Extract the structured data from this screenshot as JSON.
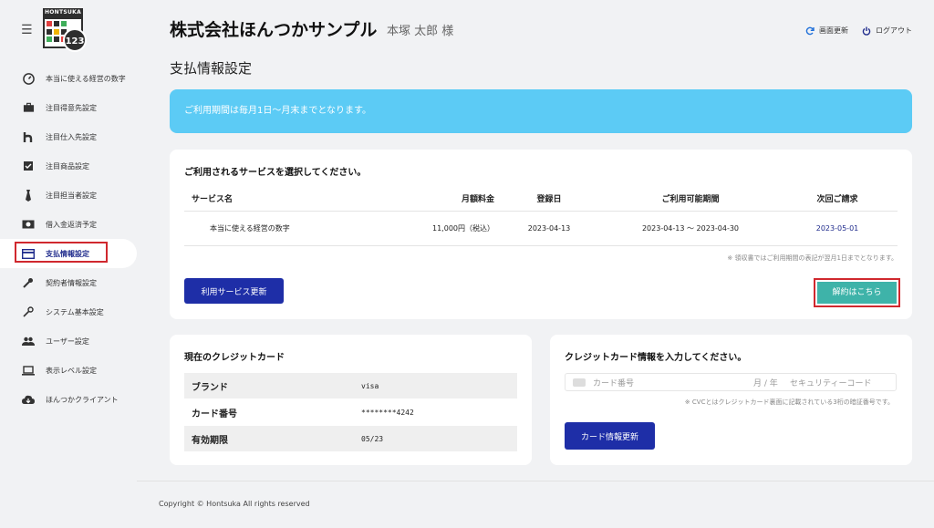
{
  "logo": {
    "text": "HONTSUKA",
    "badge": "123"
  },
  "sidebar": {
    "items": [
      {
        "label": "本当に使える経営の数字",
        "icon": "gauge-icon"
      },
      {
        "label": "注目得意先設定",
        "icon": "briefcase-icon"
      },
      {
        "label": "注目仕入先設定",
        "icon": "h-icon"
      },
      {
        "label": "注目商品設定",
        "icon": "checkbox-icon"
      },
      {
        "label": "注目担当者設定",
        "icon": "tie-icon"
      },
      {
        "label": "借入金返済予定",
        "icon": "money-icon"
      },
      {
        "label": "支払情報設定",
        "icon": "credit-card-icon",
        "active": true
      },
      {
        "label": "契約者情報設定",
        "icon": "wrench-icon"
      },
      {
        "label": "システム基本設定",
        "icon": "wrench-icon"
      },
      {
        "label": "ユーザー設定",
        "icon": "people-icon"
      },
      {
        "label": "表示レベル設定",
        "icon": "laptop-icon"
      },
      {
        "label": "ほんつかクライアント",
        "icon": "cloud-download-icon"
      }
    ]
  },
  "header": {
    "company": "株式会社ほんつかサンプル",
    "user": "本塚 太郎 様",
    "refresh_label": "画面更新",
    "logout_label": "ログアウト"
  },
  "page_title": "支払情報設定",
  "info_banner": "ご利用期間は毎月1日～月末までとなります。",
  "services": {
    "title": "ご利用されるサービスを選択してください。",
    "columns": [
      "サービス名",
      "月額料金",
      "登録日",
      "ご利用可能期間",
      "次回ご請求"
    ],
    "rows": [
      [
        "本当に使える経営の数字",
        "11,000円（税込）",
        "2023-04-13",
        "2023-04-13 ～ 2023-04-30",
        "2023-05-01"
      ]
    ],
    "note": "※ 領収書ではご利用期間の表記が翌月1日までとなります。",
    "update_button": "利用サービス更新",
    "cancel_button": "解約はこちら"
  },
  "current_card": {
    "title": "現在のクレジットカード",
    "rows": [
      {
        "key": "ブランド",
        "value": "visa"
      },
      {
        "key": "カード番号",
        "value": "********4242"
      },
      {
        "key": "有効期限",
        "value": "05/23"
      }
    ]
  },
  "new_card": {
    "title": "クレジットカード情報を入力してください。",
    "card_number_placeholder": "カード番号",
    "expiry_placeholder": "月 / 年",
    "cvc_placeholder": "セキュリティーコード",
    "note": "※ CVCとはクレジットカード裏面に記載されている3桁の暗証番号です。",
    "update_button": "カード情報更新"
  },
  "footer": {
    "copyright": "Copyright © Hontsuka All rights reserved"
  },
  "colors": {
    "accent": "#1e2ea7",
    "banner": "#5ccbf5",
    "teal": "#3eb3a9",
    "highlight": "#d0282e"
  }
}
